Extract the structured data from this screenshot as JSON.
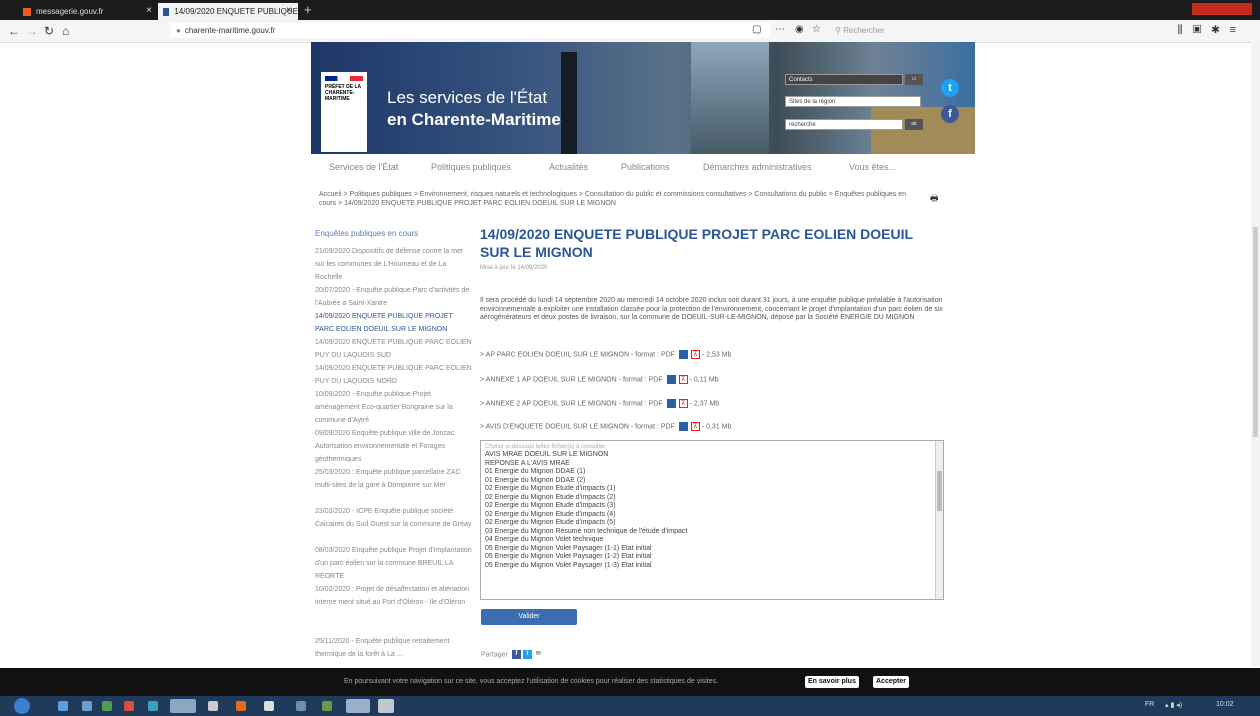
{
  "browser": {
    "tabs": [
      {
        "label": "messagerie.gouv.fr",
        "active": false
      },
      {
        "label": "14/09/2020 ENQUETE PUBLIQUE",
        "active": true
      }
    ],
    "new_tab": "+",
    "url": "charente-maritime.gouv.fr",
    "search_placeholder": "Rechercher"
  },
  "header": {
    "logo_text": "PRÉFET DE LA CHARENTE-MARITIME",
    "title_line1": "Les services de l'État",
    "title_line2": "en Charente-Maritime",
    "contact_label": "Contacts",
    "sites_label": "Sites de la région",
    "search_placeholder": "recherche",
    "ok_label": "ok",
    "twitter": "t",
    "facebook": "f"
  },
  "nav": [
    "Services de l'État",
    "Politiques publiques",
    "Actualités",
    "Publications",
    "Démarches administratives",
    "Vous êtes..."
  ],
  "breadcrumb": "Accueil > Politiques publiques > Environnement, risques naturels et technologiques > Consultation du public et commissions consultatives > Consultations du public > Enquêtes publiques en cours > 14/09/2020 ENQUETE PUBLIQUE PROJET PARC EOLIEN DOEUIL SUR LE MIGNON",
  "sidebar": {
    "title": "Enquêtes publiques en cours",
    "items": [
      "21/09/2020 Dispositifs de défense contre la mer sur les communes de L'Houmeau et de La Rochelle",
      "20/07/2020 - Enquête publique Parc d'activités de l'Aubrée a Saint-Xantre",
      "14/09/2020 ENQUETE PUBLIQUE PROJET PARC EOLIEN DOEUIL SUR LE MIGNON",
      "14/09/2020 ENQUETE PUBLIQUE PARC EOLIEN PUY DU LAQUOIS SUD",
      "14/09/2020 ENQUETE PUBLIQUE PARC EOLIEN PUY DU LAQUOIS NORD",
      "10/09/2020 - Enquête publique Projet aménagement Eco-quartier Bongraine sur la commune d'Aytré",
      "09/09/2020 Enquête publique ville de Jonzac Autorisation environnementale et Forages géothermiques",
      "25/03/2020 : Enquête publique parcellaire ZAC multi-sites de la gare à Dompierre sur Mer",
      "23/03/2020 - ICPE Enquête publique société Calcaires du Sud Ouest sur la commune de Gréay",
      "08/03/2020 Enquête publique Projet d'implantation d'un parc éolien sur la commune BREUIL LA REORTE",
      "10/02/2020 : Projet de désaffectation et aliénation interne ment situé au Port d'Oléron - Ile d'Oléron",
      "25/11/2020 - Enquête publique retraitement thermique de la forêt à La ..."
    ]
  },
  "content": {
    "title": "14/09/2020 ENQUETE PUBLIQUE PROJET PARC EOLIEN DOEUIL SUR LE MIGNON",
    "published": "Mise à jour le 14/09/2020",
    "paragraph": "Il sera procédé du lundi 14 septembre 2020 au mercredi 14 octobre 2020 inclus soit durant 31 jours, à une enquête publique préalable à l'autorisation environnementale à exploiter une installation classée pour la protection de l'environnement, concernant le projet d'implantation d'un parc éolien de six aérogénérateurs et deux postes de livraison, sur la commune de DOEUIL-SUR-LE-MIGNON, déposé par la Société ENERGIE DU MIGNON",
    "documents": [
      {
        "label": "> AP PARC EOLIEN DOEUIL SUR LE MIGNON - format : PDF",
        "size": "- 2,53 Mb"
      },
      {
        "label": "> ANNEXE 1 AP DOEUIL SUR LE MIGNON - format : PDF",
        "size": "- 0,11 Mb"
      },
      {
        "label": "> ANNEXE 2 AP DOEUIL SUR LE MIGNON - format : PDF",
        "size": "- 2,37 Mb"
      },
      {
        "label": "> AVIS D'ENQUETE DOEUIL SUR LE MIGNON - format : PDF",
        "size": "- 0,31 Mb"
      }
    ],
    "list_header": "Choisir ci-dessous le/les fichier(s) à consulter",
    "list_items": [
      "AVIS MRAE DOEUIL SUR LE MIGNON",
      "REPONSE A L'AVIS MRAE",
      "01 Energie du Mignon DDAE (1)",
      "01 Energie du Mignon DDAE (2)",
      "02 Energie du Mignon Etude d'impacts (1)",
      "02 Energie du Mignon Etude d'impacts (2)",
      "02 Energie du Mignon Etude d'impacts (3)",
      "02 Energie du Mignon Etude d'impacts (4)",
      "02 Energie du Mignon Etude d'impacts (5)",
      "03 Energie du Mignon Résumé non technique de l'étude d'impact",
      "04 Energie du Mignon Volet technique",
      "05 Energie du Mignon Volet Paysager (1-1) Etat initial",
      "05 Energie du Mignon Volet Paysager (1-2) Etat initial",
      "05 Energie du Mignon Volet Paysager (1-3) Etat initial"
    ],
    "validate_label": "Valider",
    "share_label": "Partager"
  },
  "cookie": {
    "text": "En poursuivant votre navigation sur ce site, vous acceptez l'utilisation de cookies pour réaliser des statistiques de visites.",
    "more_label": "En savoir plus",
    "accept_label": "Accepter"
  },
  "taskbar": {
    "lang": "FR",
    "time": "10:02"
  }
}
